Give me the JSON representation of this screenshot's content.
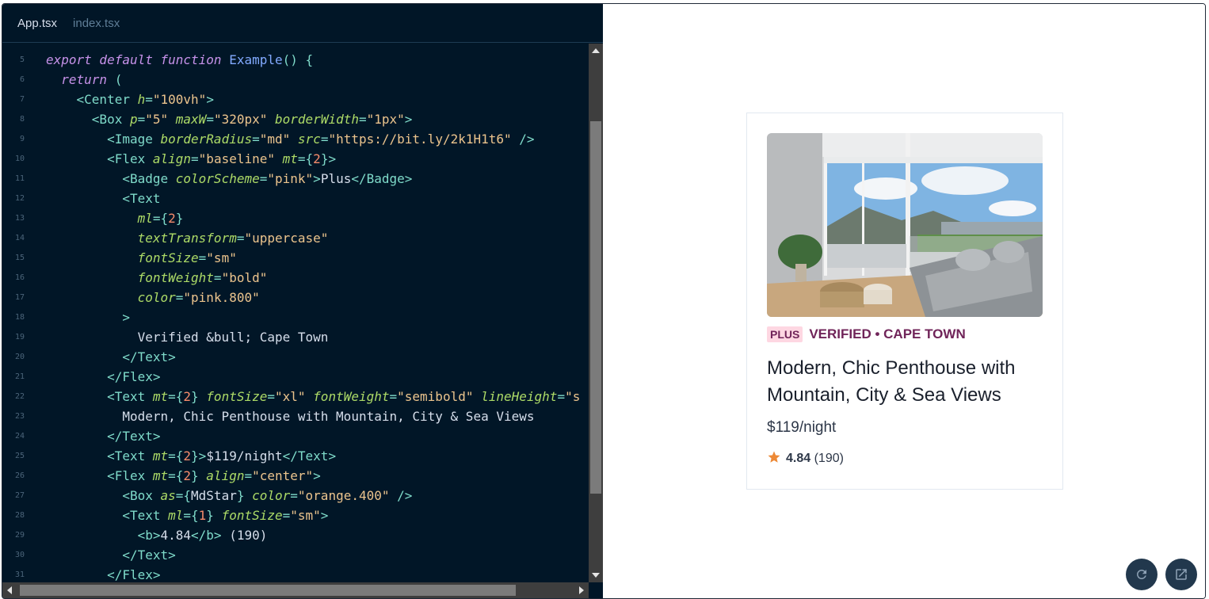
{
  "editor": {
    "tabs": [
      {
        "label": "App.tsx",
        "active": true
      },
      {
        "label": "index.tsx",
        "active": false
      }
    ],
    "lines": [
      {
        "n": "5",
        "tokens": [
          [
            "kw",
            "export default function "
          ],
          [
            "fn",
            "Example"
          ],
          [
            "pn",
            "() {"
          ]
        ]
      },
      {
        "n": "6",
        "tokens": [
          [
            "tx",
            "  "
          ],
          [
            "kw",
            "return "
          ],
          [
            "pn",
            "("
          ]
        ]
      },
      {
        "n": "7",
        "tokens": [
          [
            "tx",
            "    "
          ],
          [
            "tg",
            "<Center "
          ],
          [
            "at",
            "h"
          ],
          [
            "pn",
            "="
          ],
          [
            "st",
            "\"100vh\""
          ],
          [
            "tg",
            ">"
          ]
        ]
      },
      {
        "n": "8",
        "tokens": [
          [
            "tx",
            "      "
          ],
          [
            "tg",
            "<Box "
          ],
          [
            "at",
            "p"
          ],
          [
            "pn",
            "="
          ],
          [
            "st",
            "\"5\" "
          ],
          [
            "at",
            "maxW"
          ],
          [
            "pn",
            "="
          ],
          [
            "st",
            "\"320px\" "
          ],
          [
            "at",
            "borderWidth"
          ],
          [
            "pn",
            "="
          ],
          [
            "st",
            "\"1px\""
          ],
          [
            "tg",
            ">"
          ]
        ]
      },
      {
        "n": "9",
        "tokens": [
          [
            "tx",
            "        "
          ],
          [
            "tg",
            "<Image "
          ],
          [
            "at",
            "borderRadius"
          ],
          [
            "pn",
            "="
          ],
          [
            "st",
            "\"md\" "
          ],
          [
            "at",
            "src"
          ],
          [
            "pn",
            "="
          ],
          [
            "st",
            "\"https://bit.ly/2k1H1t6\" "
          ],
          [
            "tg",
            "/>"
          ]
        ]
      },
      {
        "n": "10",
        "tokens": [
          [
            "tx",
            "        "
          ],
          [
            "tg",
            "<Flex "
          ],
          [
            "at",
            "align"
          ],
          [
            "pn",
            "="
          ],
          [
            "st",
            "\"baseline\" "
          ],
          [
            "at",
            "mt"
          ],
          [
            "pn",
            "={"
          ],
          [
            "nu",
            "2"
          ],
          [
            "pn",
            "}"
          ],
          [
            "tg",
            ">"
          ]
        ]
      },
      {
        "n": "11",
        "tokens": [
          [
            "tx",
            "          "
          ],
          [
            "tg",
            "<Badge "
          ],
          [
            "at",
            "colorScheme"
          ],
          [
            "pn",
            "="
          ],
          [
            "st",
            "\"pink\""
          ],
          [
            "tg",
            ">"
          ],
          [
            "tx",
            "Plus"
          ],
          [
            "tg",
            "</Badge>"
          ]
        ]
      },
      {
        "n": "12",
        "tokens": [
          [
            "tx",
            "          "
          ],
          [
            "tg",
            "<Text"
          ]
        ]
      },
      {
        "n": "13",
        "tokens": [
          [
            "tx",
            "            "
          ],
          [
            "at",
            "ml"
          ],
          [
            "pn",
            "={"
          ],
          [
            "nu",
            "2"
          ],
          [
            "pn",
            "}"
          ]
        ]
      },
      {
        "n": "14",
        "tokens": [
          [
            "tx",
            "            "
          ],
          [
            "at",
            "textTransform"
          ],
          [
            "pn",
            "="
          ],
          [
            "st",
            "\"uppercase\""
          ]
        ]
      },
      {
        "n": "15",
        "tokens": [
          [
            "tx",
            "            "
          ],
          [
            "at",
            "fontSize"
          ],
          [
            "pn",
            "="
          ],
          [
            "st",
            "\"sm\""
          ]
        ]
      },
      {
        "n": "16",
        "tokens": [
          [
            "tx",
            "            "
          ],
          [
            "at",
            "fontWeight"
          ],
          [
            "pn",
            "="
          ],
          [
            "st",
            "\"bold\""
          ]
        ]
      },
      {
        "n": "17",
        "tokens": [
          [
            "tx",
            "            "
          ],
          [
            "at",
            "color"
          ],
          [
            "pn",
            "="
          ],
          [
            "st",
            "\"pink.800\""
          ]
        ]
      },
      {
        "n": "18",
        "tokens": [
          [
            "tx",
            "          "
          ],
          [
            "tg",
            ">"
          ]
        ]
      },
      {
        "n": "19",
        "tokens": [
          [
            "tx",
            "            Verified &bull; Cape Town"
          ]
        ]
      },
      {
        "n": "20",
        "tokens": [
          [
            "tx",
            "          "
          ],
          [
            "tg",
            "</Text>"
          ]
        ]
      },
      {
        "n": "21",
        "tokens": [
          [
            "tx",
            "        "
          ],
          [
            "tg",
            "</Flex>"
          ]
        ]
      },
      {
        "n": "22",
        "tokens": [
          [
            "tx",
            "        "
          ],
          [
            "tg",
            "<Text "
          ],
          [
            "at",
            "mt"
          ],
          [
            "pn",
            "={"
          ],
          [
            "nu",
            "2"
          ],
          [
            "pn",
            "} "
          ],
          [
            "at",
            "fontSize"
          ],
          [
            "pn",
            "="
          ],
          [
            "st",
            "\"xl\" "
          ],
          [
            "at",
            "fontWeight"
          ],
          [
            "pn",
            "="
          ],
          [
            "st",
            "\"semibold\" "
          ],
          [
            "at",
            "lineHeight"
          ],
          [
            "pn",
            "="
          ],
          [
            "st",
            "\"s"
          ]
        ]
      },
      {
        "n": "23",
        "tokens": [
          [
            "tx",
            "          Modern, Chic Penthouse with Mountain, City & Sea Views"
          ]
        ]
      },
      {
        "n": "24",
        "tokens": [
          [
            "tx",
            "        "
          ],
          [
            "tg",
            "</Text>"
          ]
        ]
      },
      {
        "n": "25",
        "tokens": [
          [
            "tx",
            "        "
          ],
          [
            "tg",
            "<Text "
          ],
          [
            "at",
            "mt"
          ],
          [
            "pn",
            "={"
          ],
          [
            "nu",
            "2"
          ],
          [
            "pn",
            "}"
          ],
          [
            "tg",
            ">"
          ],
          [
            "tx",
            "$119/night"
          ],
          [
            "tg",
            "</Text>"
          ]
        ]
      },
      {
        "n": "26",
        "tokens": [
          [
            "tx",
            "        "
          ],
          [
            "tg",
            "<Flex "
          ],
          [
            "at",
            "mt"
          ],
          [
            "pn",
            "={"
          ],
          [
            "nu",
            "2"
          ],
          [
            "pn",
            "} "
          ],
          [
            "at",
            "align"
          ],
          [
            "pn",
            "="
          ],
          [
            "st",
            "\"center\""
          ],
          [
            "tg",
            ">"
          ]
        ]
      },
      {
        "n": "27",
        "tokens": [
          [
            "tx",
            "          "
          ],
          [
            "tg",
            "<Box "
          ],
          [
            "at",
            "as"
          ],
          [
            "pn",
            "={"
          ],
          [
            "tx",
            "MdStar"
          ],
          [
            "pn",
            "} "
          ],
          [
            "at",
            "color"
          ],
          [
            "pn",
            "="
          ],
          [
            "st",
            "\"orange.400\" "
          ],
          [
            "tg",
            "/>"
          ]
        ]
      },
      {
        "n": "28",
        "tokens": [
          [
            "tx",
            "          "
          ],
          [
            "tg",
            "<Text "
          ],
          [
            "at",
            "ml"
          ],
          [
            "pn",
            "={"
          ],
          [
            "nu",
            "1"
          ],
          [
            "pn",
            "} "
          ],
          [
            "at",
            "fontSize"
          ],
          [
            "pn",
            "="
          ],
          [
            "st",
            "\"sm\""
          ],
          [
            "tg",
            ">"
          ]
        ]
      },
      {
        "n": "29",
        "tokens": [
          [
            "tx",
            "            "
          ],
          [
            "tg",
            "<b>"
          ],
          [
            "tx",
            "4.84"
          ],
          [
            "tg",
            "</b>"
          ],
          [
            "tx",
            " (190)"
          ]
        ]
      },
      {
        "n": "30",
        "tokens": [
          [
            "tx",
            "          "
          ],
          [
            "tg",
            "</Text>"
          ]
        ]
      },
      {
        "n": "31",
        "tokens": [
          [
            "tx",
            "        "
          ],
          [
            "tg",
            "</Flex>"
          ]
        ]
      }
    ]
  },
  "preview": {
    "badge": "Plus",
    "verified": "Verified • Cape Town",
    "title": "Modern, Chic Penthouse with Mountain, City & Sea Views",
    "price": "$119/night",
    "rating_value": "4.84",
    "rating_count": "(190)",
    "star_color": "#ed8936"
  }
}
